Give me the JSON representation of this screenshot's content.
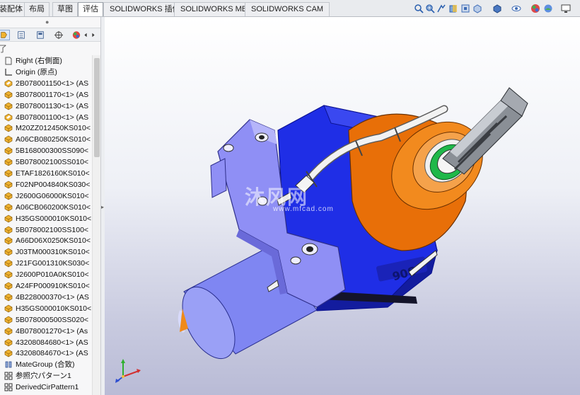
{
  "tabs": [
    {
      "label": "装配体",
      "active": false
    },
    {
      "label": "布局",
      "active": false
    },
    {
      "label": "草图",
      "active": false
    },
    {
      "label": "评估",
      "active": true
    },
    {
      "label": "SOLIDWORKS 插件",
      "active": false
    },
    {
      "label": "SOLIDWORKS MBD",
      "active": false
    },
    {
      "label": "SOLIDWORKS CAM",
      "active": false
    }
  ],
  "heads_up_icons": [
    "search-icon",
    "zoom-area-icon",
    "previous-view-icon",
    "section-view-icon",
    "view-orientation-icon",
    "display-style-icon",
    "hide-show-icon",
    "appearance-icon",
    "scene-icon",
    "monitor-icon"
  ],
  "panel": {
    "toolbar_icons": [
      "feature-tree-icon",
      "property-manager-icon",
      "configuration-icon",
      "dim-expert-icon",
      "display-manager-icon"
    ],
    "filter_glyph": "了",
    "tree": [
      {
        "label": "Right (右側面)",
        "icon": "plane-icon"
      },
      {
        "label": "Origin (原点)",
        "icon": "origin-icon"
      },
      {
        "label": "2B078001150<1> (AS",
        "icon": "part-fixed-icon"
      },
      {
        "label": "3B078001170<1> (AS",
        "icon": "part-icon"
      },
      {
        "label": "2B078001130<1> (AS",
        "icon": "part-icon"
      },
      {
        "label": "4B078001100<1> (AS",
        "icon": "part-fixed-icon"
      },
      {
        "label": "M20ZZ012450KS010<",
        "icon": "part-icon"
      },
      {
        "label": "A06CB080250KS010<",
        "icon": "part-icon"
      },
      {
        "label": "5B168000300SS090<",
        "icon": "part-icon"
      },
      {
        "label": "5B078002100SS010<",
        "icon": "part-icon"
      },
      {
        "label": "ETAF1826160KS010<",
        "icon": "part-icon"
      },
      {
        "label": "F02NP004840KS030<",
        "icon": "part-icon"
      },
      {
        "label": "J2600G06000KS010<",
        "icon": "part-icon"
      },
      {
        "label": "A06CB060200KS010<",
        "icon": "part-icon"
      },
      {
        "label": "H35GS000010KS010<",
        "icon": "part-icon"
      },
      {
        "label": "5B078002100SS100<",
        "icon": "part-icon"
      },
      {
        "label": "A66D06X0250KS010<",
        "icon": "part-icon"
      },
      {
        "label": "J03TM000310KS010<",
        "icon": "part-icon"
      },
      {
        "label": "J21FG001310KS030<",
        "icon": "part-icon"
      },
      {
        "label": "J2600P010A0KS010<",
        "icon": "part-icon"
      },
      {
        "label": "A24FP000910KS010<",
        "icon": "part-icon"
      },
      {
        "label": "4B228000370<1> (AS",
        "icon": "part-icon"
      },
      {
        "label": "H35GS000010KS010<",
        "icon": "part-icon"
      },
      {
        "label": "5B078000500SS020<",
        "icon": "part-icon"
      },
      {
        "label": "4B078001270<1> (As",
        "icon": "part-icon"
      },
      {
        "label": "43208084680<1> (AS",
        "icon": "part-icon"
      },
      {
        "label": "43208084670<1> (AS",
        "icon": "part-icon"
      },
      {
        "label": "MateGroup (合致)",
        "icon": "mate-group-icon"
      },
      {
        "label": "参照穴パターン1",
        "icon": "pattern-icon"
      },
      {
        "label": "DerivedCirPattern1",
        "icon": "pattern-icon"
      }
    ]
  },
  "viewport": {
    "watermark": "沐风网",
    "watermark_sub": "www.mfcad.com",
    "part_marking": "306",
    "colors": {
      "body": "#1f2ee6",
      "bracket": "#8f8ff5",
      "holder": "#f07c10",
      "motor": "#7f86f2",
      "tool": "#8a8f96",
      "bearing": "#1fb84a"
    }
  }
}
